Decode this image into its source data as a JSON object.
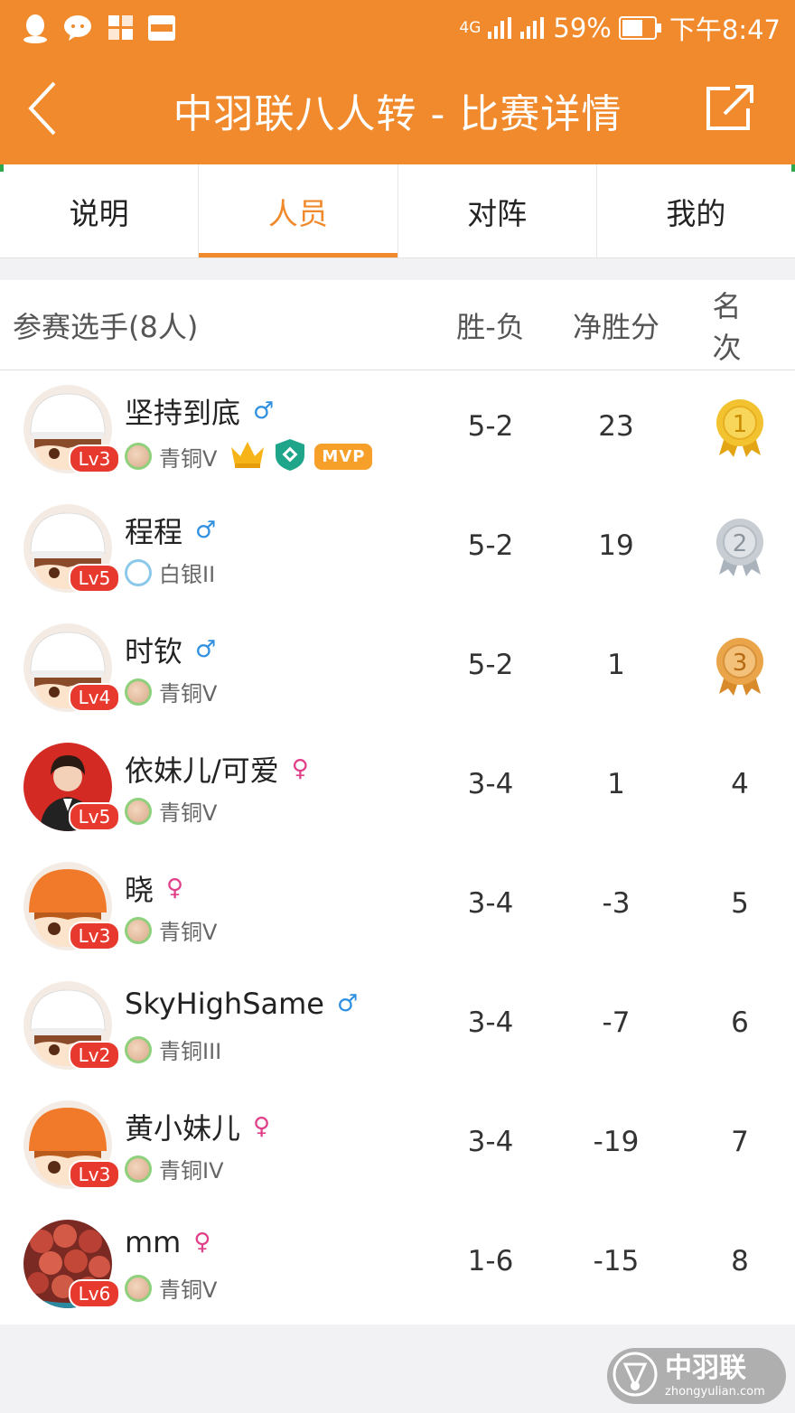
{
  "status_bar": {
    "network": "4G",
    "battery": "59%",
    "time": "下午8:47"
  },
  "header": {
    "title": "中羽联八人转 - 比赛详情"
  },
  "tabs": [
    {
      "label": "说明",
      "active": false
    },
    {
      "label": "人员",
      "active": true
    },
    {
      "label": "对阵",
      "active": false
    },
    {
      "label": "我的",
      "active": false
    }
  ],
  "table": {
    "headers": {
      "players": "参赛选手(8人)",
      "win_loss": "胜-负",
      "net_points": "净胜分",
      "rank": "名次"
    },
    "rows": [
      {
        "name": "坚持到底",
        "gender": "♂",
        "level": "Lv3",
        "tier": "青铜V",
        "win_loss": "5-2",
        "net": "23",
        "rank": "1",
        "mvp": "MVP"
      },
      {
        "name": "程程",
        "gender": "♂",
        "level": "Lv5",
        "tier": "白银II",
        "win_loss": "5-2",
        "net": "19",
        "rank": "2"
      },
      {
        "name": "时钦",
        "gender": "♂",
        "level": "Lv4",
        "tier": "青铜V",
        "win_loss": "5-2",
        "net": "1",
        "rank": "3"
      },
      {
        "name": "依妹儿/可爱",
        "gender": "♀",
        "level": "Lv5",
        "tier": "青铜V",
        "win_loss": "3-4",
        "net": "1",
        "rank": "4"
      },
      {
        "name": "晓",
        "gender": "♀",
        "level": "Lv3",
        "tier": "青铜V",
        "win_loss": "3-4",
        "net": "-3",
        "rank": "5"
      },
      {
        "name": "SkyHighSame",
        "gender": "♂",
        "level": "Lv2",
        "tier": "青铜III",
        "win_loss": "3-4",
        "net": "-7",
        "rank": "6"
      },
      {
        "name": "黄小妹儿",
        "gender": "♀",
        "level": "Lv3",
        "tier": "青铜IV",
        "win_loss": "3-4",
        "net": "-19",
        "rank": "7"
      },
      {
        "name": "mm",
        "gender": "♀",
        "level": "Lv6",
        "tier": "青铜V",
        "win_loss": "1-6",
        "net": "-15",
        "rank": "8"
      }
    ]
  },
  "watermark": {
    "title": "中羽联",
    "subtitle": "zhongyulian.com"
  },
  "colors": {
    "brand_orange": "#f08a2c",
    "male_blue": "#2f8fe0",
    "female_pink": "#e0408a",
    "level_red": "#e8392e",
    "gold": "#f2c230",
    "silver": "#c7cdd3",
    "bronze": "#eaa54a"
  }
}
